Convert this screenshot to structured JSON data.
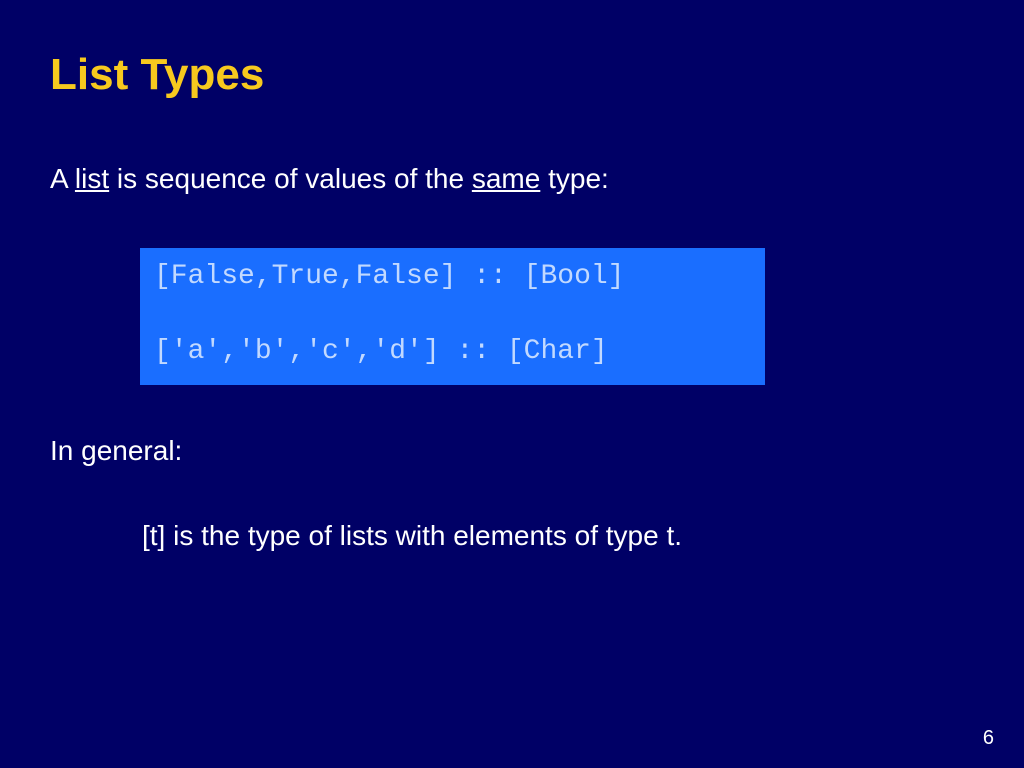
{
  "title": "List Types",
  "intro_prefix": "A ",
  "intro_u1": "list",
  "intro_mid": " is sequence of values of the ",
  "intro_u2": "same",
  "intro_suffix": " type:",
  "code_line1": "[False,True,False] :: [Bool]",
  "code_line2": "['a','b','c','d'] :: [Char]",
  "in_general": "In general:",
  "conclusion": "[t] is the type of lists with elements of type t.",
  "page_number": "6"
}
